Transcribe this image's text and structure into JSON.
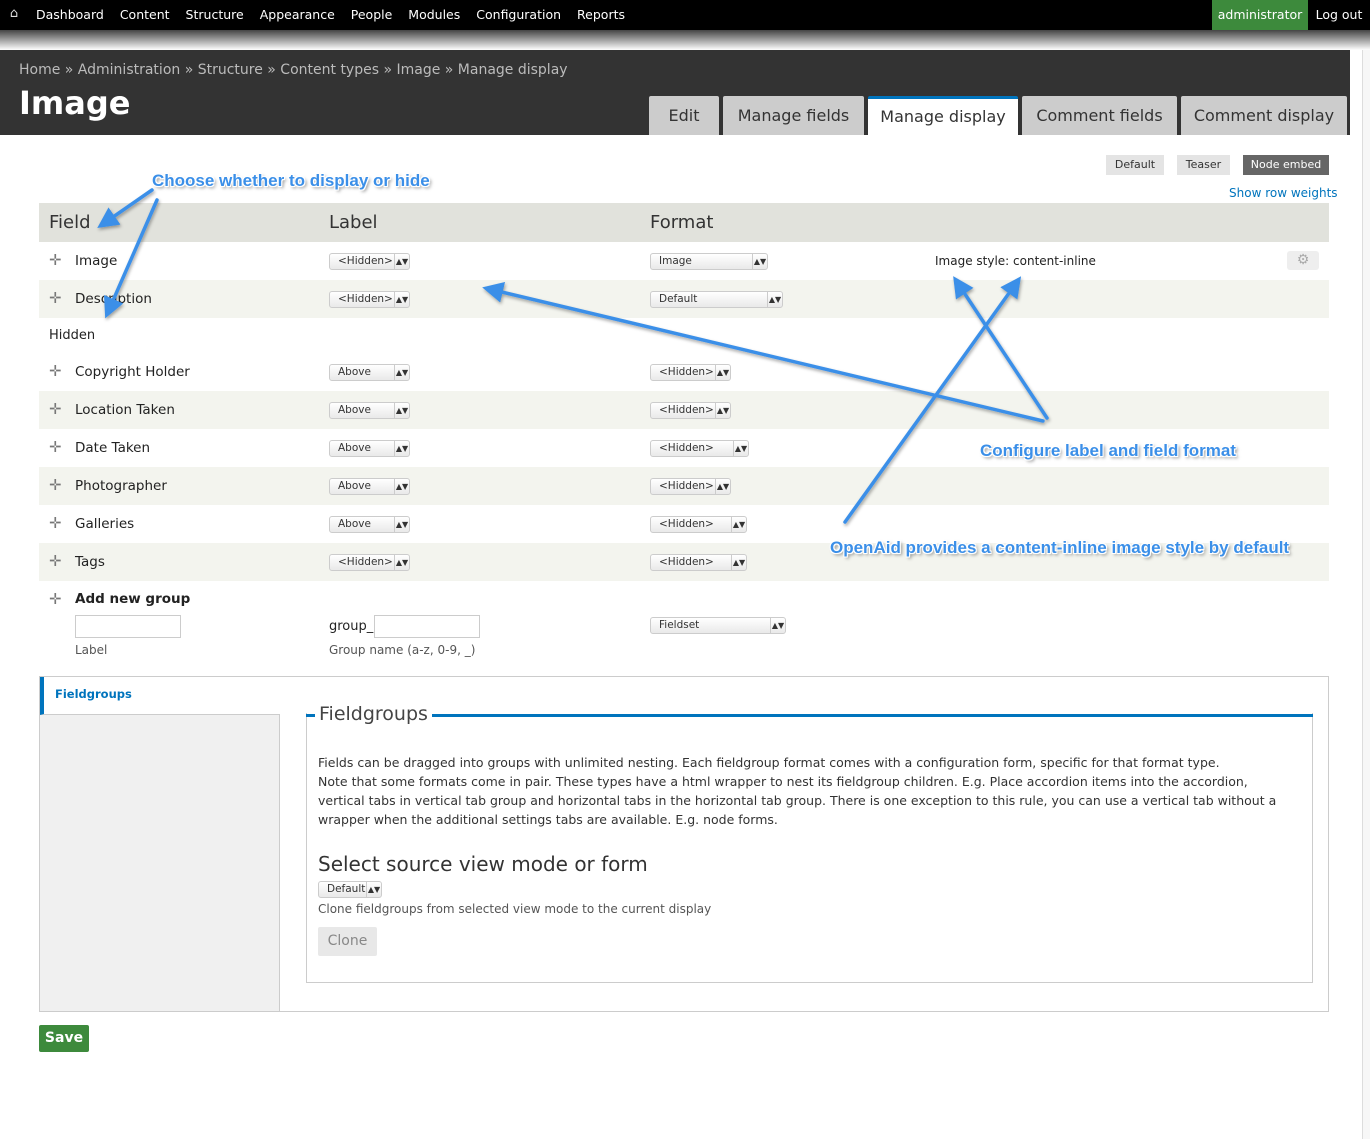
{
  "toolbar": {
    "menu": [
      "Dashboard",
      "Content",
      "Structure",
      "Appearance",
      "People",
      "Modules",
      "Configuration",
      "Reports"
    ],
    "user": "administrator",
    "logout": "Log out",
    "home_icon": "home-icon"
  },
  "header": {
    "breadcrumb": "Home » Administration » Structure » Content types » Image » Manage display",
    "title": "Image",
    "tabs": [
      "Edit",
      "Manage fields",
      "Manage display",
      "Comment fields",
      "Comment display"
    ],
    "active_tab": "Manage display"
  },
  "view_modes": [
    "Default",
    "Teaser",
    "Node embed"
  ],
  "active_view_mode": "Node embed",
  "show_row_weights": "Show row weights",
  "table": {
    "headers": [
      "Field",
      "Label",
      "Format"
    ],
    "rows": [
      {
        "field": "Image",
        "label": "<Hidden>",
        "format": "Image",
        "summary": "Image style: content-inline"
      },
      {
        "field": "Description",
        "label": "<Hidden>",
        "format": "Default"
      }
    ],
    "hidden_region": "Hidden",
    "hidden_rows": [
      {
        "field": "Copyright Holder",
        "label": "Above",
        "format": "<Hidden>"
      },
      {
        "field": "Location Taken",
        "label": "Above",
        "format": "<Hidden>"
      },
      {
        "field": "Date Taken",
        "label": "Above",
        "format": "<Hidden>"
      },
      {
        "field": "Photographer",
        "label": "Above",
        "format": "<Hidden>"
      },
      {
        "field": "Galleries",
        "label": "Above",
        "format": "<Hidden>"
      },
      {
        "field": "Tags",
        "label": "<Hidden>",
        "format": "<Hidden>"
      }
    ],
    "add_group": {
      "title": "Add new group",
      "label_caption": "Label",
      "prefix": "group_",
      "name_caption": "Group name (a-z, 0-9, _)",
      "format": "Fieldset"
    }
  },
  "fieldgroups": {
    "tab": "Fieldgroups",
    "legend": "Fieldgroups",
    "description_1": "Fields can be dragged into groups with unlimited nesting. Each fieldgroup format comes with a configuration form, specific for that format type.",
    "description_2": "Note that some formats come in pair. These types have a html wrapper to nest its fieldgroup children. E.g. Place accordion items into the accordion, vertical tabs in vertical tab group and horizontal tabs in the horizontal tab group. There is one exception to this rule, you can use a vertical tab without a wrapper when the additional settings tabs are available. E.g. node forms.",
    "source_heading": "Select source view mode or form",
    "source_value": "Default",
    "clone_description": "Clone fieldgroups from selected view mode to the current display",
    "clone_button": "Clone"
  },
  "save_button": "Save",
  "annotations": {
    "display_or_hide": "Choose whether to display or hide",
    "configure": "Configure label and field format",
    "openaid": "OpenAid provides a content-inline image style by default",
    "color": "#3b8fe8"
  }
}
